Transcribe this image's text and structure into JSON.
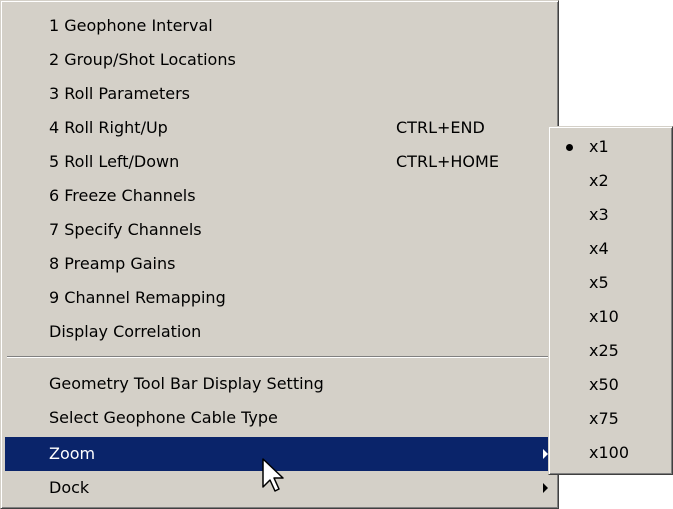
{
  "menu": {
    "items": [
      {
        "label": "1 Geophone Interval",
        "shortcut": "",
        "submenu": false,
        "highlighted": false
      },
      {
        "label": "2 Group/Shot Locations",
        "shortcut": "",
        "submenu": false,
        "highlighted": false
      },
      {
        "label": "3 Roll Parameters",
        "shortcut": "",
        "submenu": false,
        "highlighted": false
      },
      {
        "label": "4 Roll Right/Up",
        "shortcut": "CTRL+END",
        "submenu": false,
        "highlighted": false
      },
      {
        "label": "5 Roll Left/Down",
        "shortcut": "CTRL+HOME",
        "submenu": false,
        "highlighted": false
      },
      {
        "label": "6 Freeze Channels",
        "shortcut": "",
        "submenu": false,
        "highlighted": false
      },
      {
        "label": "7 Specify Channels",
        "shortcut": "",
        "submenu": false,
        "highlighted": false
      },
      {
        "label": "8 Preamp Gains",
        "shortcut": "",
        "submenu": false,
        "highlighted": false
      },
      {
        "label": "9 Channel Remapping",
        "shortcut": "",
        "submenu": false,
        "highlighted": false
      },
      {
        "label": "Display Correlation",
        "shortcut": "",
        "submenu": false,
        "highlighted": false
      },
      {
        "label": "Geometry Tool Bar Display Setting",
        "shortcut": "",
        "submenu": false,
        "highlighted": false
      },
      {
        "label": "Select Geophone Cable Type",
        "shortcut": "",
        "submenu": false,
        "highlighted": false
      },
      {
        "label": "Zoom",
        "shortcut": "",
        "submenu": true,
        "highlighted": true
      },
      {
        "label": "Dock",
        "shortcut": "",
        "submenu": true,
        "highlighted": false
      }
    ]
  },
  "zoom_submenu": {
    "selected": "x1",
    "items": [
      "x1",
      "x2",
      "x3",
      "x4",
      "x5",
      "x10",
      "x25",
      "x50",
      "x75",
      "x100"
    ]
  },
  "colors": {
    "menu_background": "#d4d0c8",
    "highlight": "#0a246a",
    "highlight_text": "#ffffff"
  },
  "icons": {
    "submenu_arrow": "chevron-right-icon",
    "selection_bullet": "radio-bullet-icon",
    "pointer": "mouse-cursor-icon"
  }
}
